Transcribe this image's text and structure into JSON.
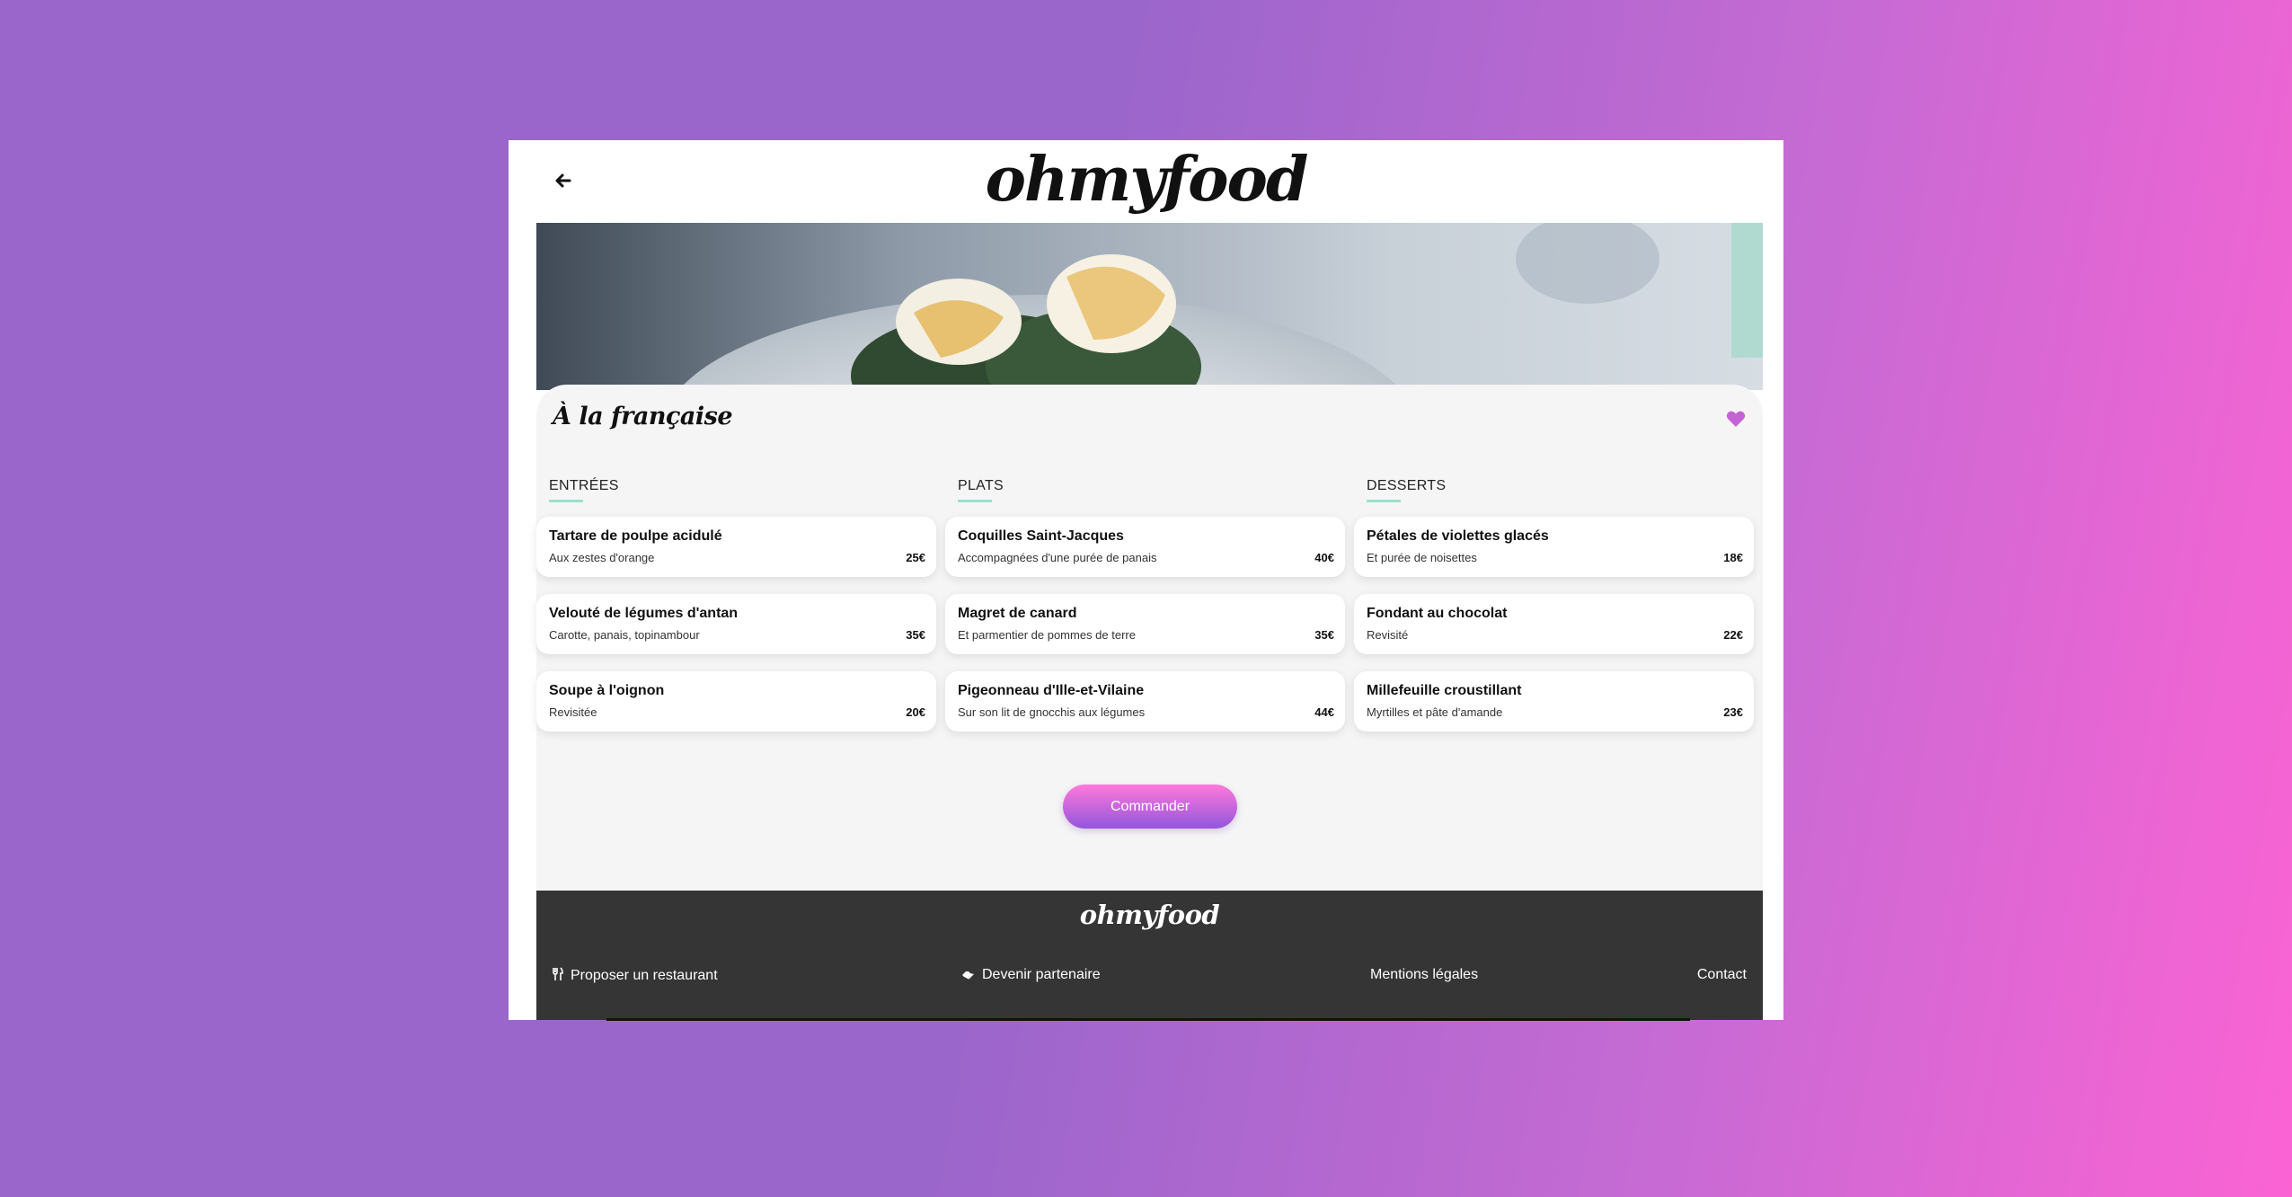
{
  "header": {
    "logo": "ohmyfood",
    "back_icon": "arrow-left-icon"
  },
  "restaurant": {
    "name": "À la française",
    "favorite_icon": "heart-icon",
    "favorite_color": "#c562d4"
  },
  "menu": {
    "columns": [
      {
        "title": "ENTRÉES",
        "items": [
          {
            "name": "Tartare de poulpe acidulé",
            "description": "Aux zestes d'orange",
            "price": "25€"
          },
          {
            "name": "Velouté de légumes d'antan",
            "description": "Carotte, panais, topinambour",
            "price": "35€"
          },
          {
            "name": "Soupe à l'oignon",
            "description": "Revisitée",
            "price": "20€"
          }
        ]
      },
      {
        "title": "PLATS",
        "items": [
          {
            "name": "Coquilles Saint-Jacques",
            "description": "Accompagnées d'une purée de panais",
            "price": "40€"
          },
          {
            "name": "Magret de canard",
            "description": "Et parmentier de pommes de terre",
            "price": "35€"
          },
          {
            "name": "Pigeonneau d'Ille-et-Vilaine",
            "description": "Sur son lit de gnocchis aux légumes",
            "price": "44€"
          }
        ]
      },
      {
        "title": "DESSERTS",
        "items": [
          {
            "name": "Pétales de violettes glacés",
            "description": "Et purée de noisettes",
            "price": "18€"
          },
          {
            "name": "Fondant au chocolat",
            "description": "Revisité",
            "price": "22€"
          },
          {
            "name": "Millefeuille croustillant",
            "description": "Myrtilles et pâte d'amande",
            "price": "23€"
          }
        ]
      }
    ]
  },
  "order_button": {
    "label": "Commander"
  },
  "footer": {
    "logo": "ohmyfood",
    "links": [
      {
        "label": "Proposer un restaurant",
        "icon": "utensils-icon"
      },
      {
        "label": "Devenir partenaire",
        "icon": "handshake-icon"
      },
      {
        "label": "Mentions légales"
      },
      {
        "label": "Contact"
      }
    ]
  },
  "colors": {
    "accent_underline": "#99e2d0",
    "button_gradient_top": "#ff79da",
    "button_gradient_bottom": "#9356dc",
    "footer_bg": "#353535"
  }
}
